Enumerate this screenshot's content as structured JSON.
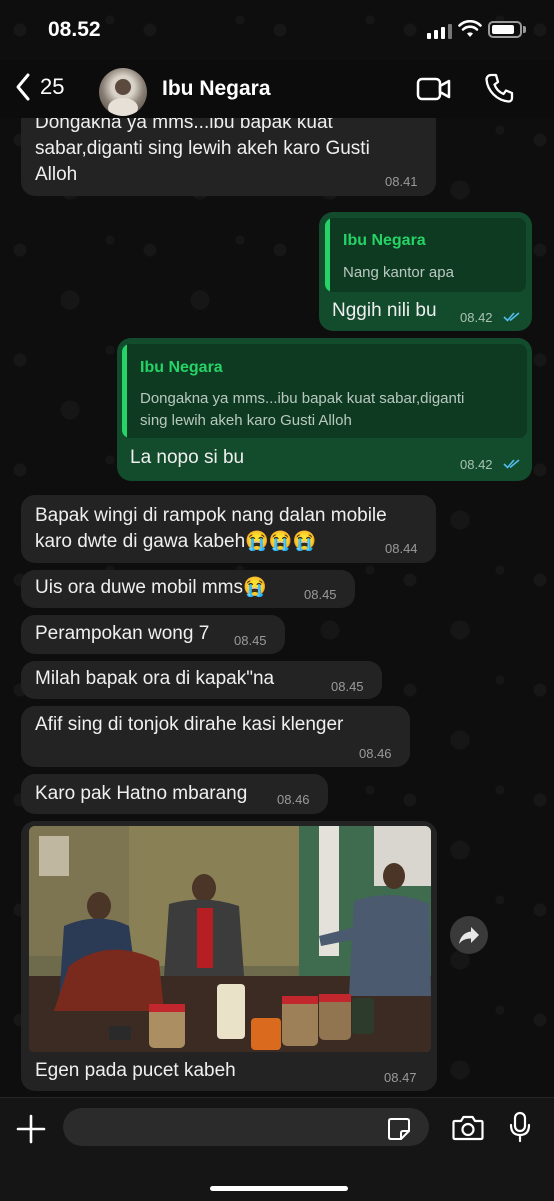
{
  "status_bar": {
    "time": "08.52"
  },
  "header": {
    "back_count": "25",
    "contact_name": "Ibu Negara"
  },
  "messages": [
    {
      "text": "Dongakna ya mms...ibu bapak  kuat",
      "text2": "sabar,diganti sing lewih akeh karo Gusti",
      "text3": "Alloh",
      "time": "08.41"
    },
    {
      "quote_name": "Ibu Negara",
      "quote_text": "Nang kantor apa",
      "text": "Nggih nili bu",
      "time": "08.42"
    },
    {
      "quote_name": "Ibu Negara",
      "quote_text": "Dongakna ya mms...ibu bapak  kuat sabar,diganti",
      "quote_text2": "sing lewih akeh karo Gusti Alloh",
      "text": "La nopo si bu",
      "time": "08.42"
    },
    {
      "text": "Bapak wingi di rampok nang dalan mobile",
      "text2": "karo dwte di gawa kabeh😭😭😭",
      "time": "08.44"
    },
    {
      "text": "Uis ora duwe mobil mms😭",
      "time": "08.45"
    },
    {
      "text": "Perampokan wong 7",
      "time": "08.45"
    },
    {
      "text": "Milah bapak ora di kapak\"na",
      "time": "08.45"
    },
    {
      "text": "Afif sing di tonjok dirahe kasi klenger",
      "time": "08.46"
    },
    {
      "text": "Karo pak Hatno mbarang",
      "time": "08.46"
    },
    {
      "caption": "Egen pada pucet kabeh",
      "time": "08.47"
    }
  ],
  "colors": {
    "accent": "#25d366",
    "outgoing_bubble": "#134b2d",
    "incoming_bubble": "#232323",
    "read_ticks": "#53bdeb"
  }
}
